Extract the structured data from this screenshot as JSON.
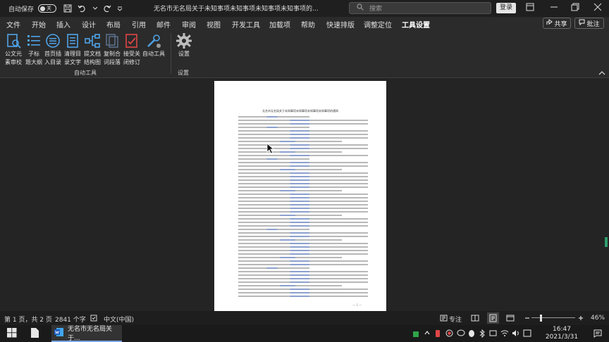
{
  "titlebar": {
    "autosave_label": "自动保存",
    "autosave_state": "关",
    "doc_title": "无名市无名局关于未知事项未知事项未知事项未知事项的...",
    "search_placeholder": "搜索",
    "login_label": "登录"
  },
  "menu": {
    "tabs": [
      "文件",
      "开始",
      "插入",
      "设计",
      "布局",
      "引用",
      "邮件",
      "审阅",
      "视图",
      "开发工具",
      "加载项",
      "帮助",
      "快速排版",
      "调整定位",
      "工具设置"
    ],
    "active_tab": "工具设置",
    "share_label": "共享",
    "comment_label": "批注"
  },
  "ribbon": {
    "buttons": [
      {
        "line1": "公文元",
        "line2": "素审校",
        "icon": "document-review-icon"
      },
      {
        "line1": "子标",
        "line2": "题大纲",
        "icon": "outline-list-icon"
      },
      {
        "line1": "首页插",
        "line2": "入目录",
        "icon": "insert-toc-icon"
      },
      {
        "line1": "清理目",
        "line2": "录文字",
        "icon": "clear-toc-icon"
      },
      {
        "line1": "提文档",
        "line2": "结构图",
        "icon": "structure-map-icon"
      },
      {
        "line1": "复制合",
        "line2": "词段落",
        "icon": "copy-merge-icon"
      },
      {
        "line1": "接受关",
        "line2": "闭修订",
        "icon": "accept-revision-icon"
      },
      {
        "line1": "自动工具",
        "line2": "",
        "icon": "auto-tool-icon"
      }
    ],
    "group1_label": "自动工具",
    "settings_button": "设置",
    "group2_label": "设置"
  },
  "document": {
    "page_title": "无名市无名局关于未知事项未知事项未知事项未知事项的通知",
    "page_number": "— 1 —"
  },
  "statusbar": {
    "page": "第 1 页，共 2 页",
    "words": "2841 个字",
    "language": "中文(中国)",
    "focus": "专注",
    "zoom": "46%"
  },
  "taskbar": {
    "word_task_label": "无名市无名局关于...",
    "time": "16:47",
    "date": "2021/3/31"
  }
}
